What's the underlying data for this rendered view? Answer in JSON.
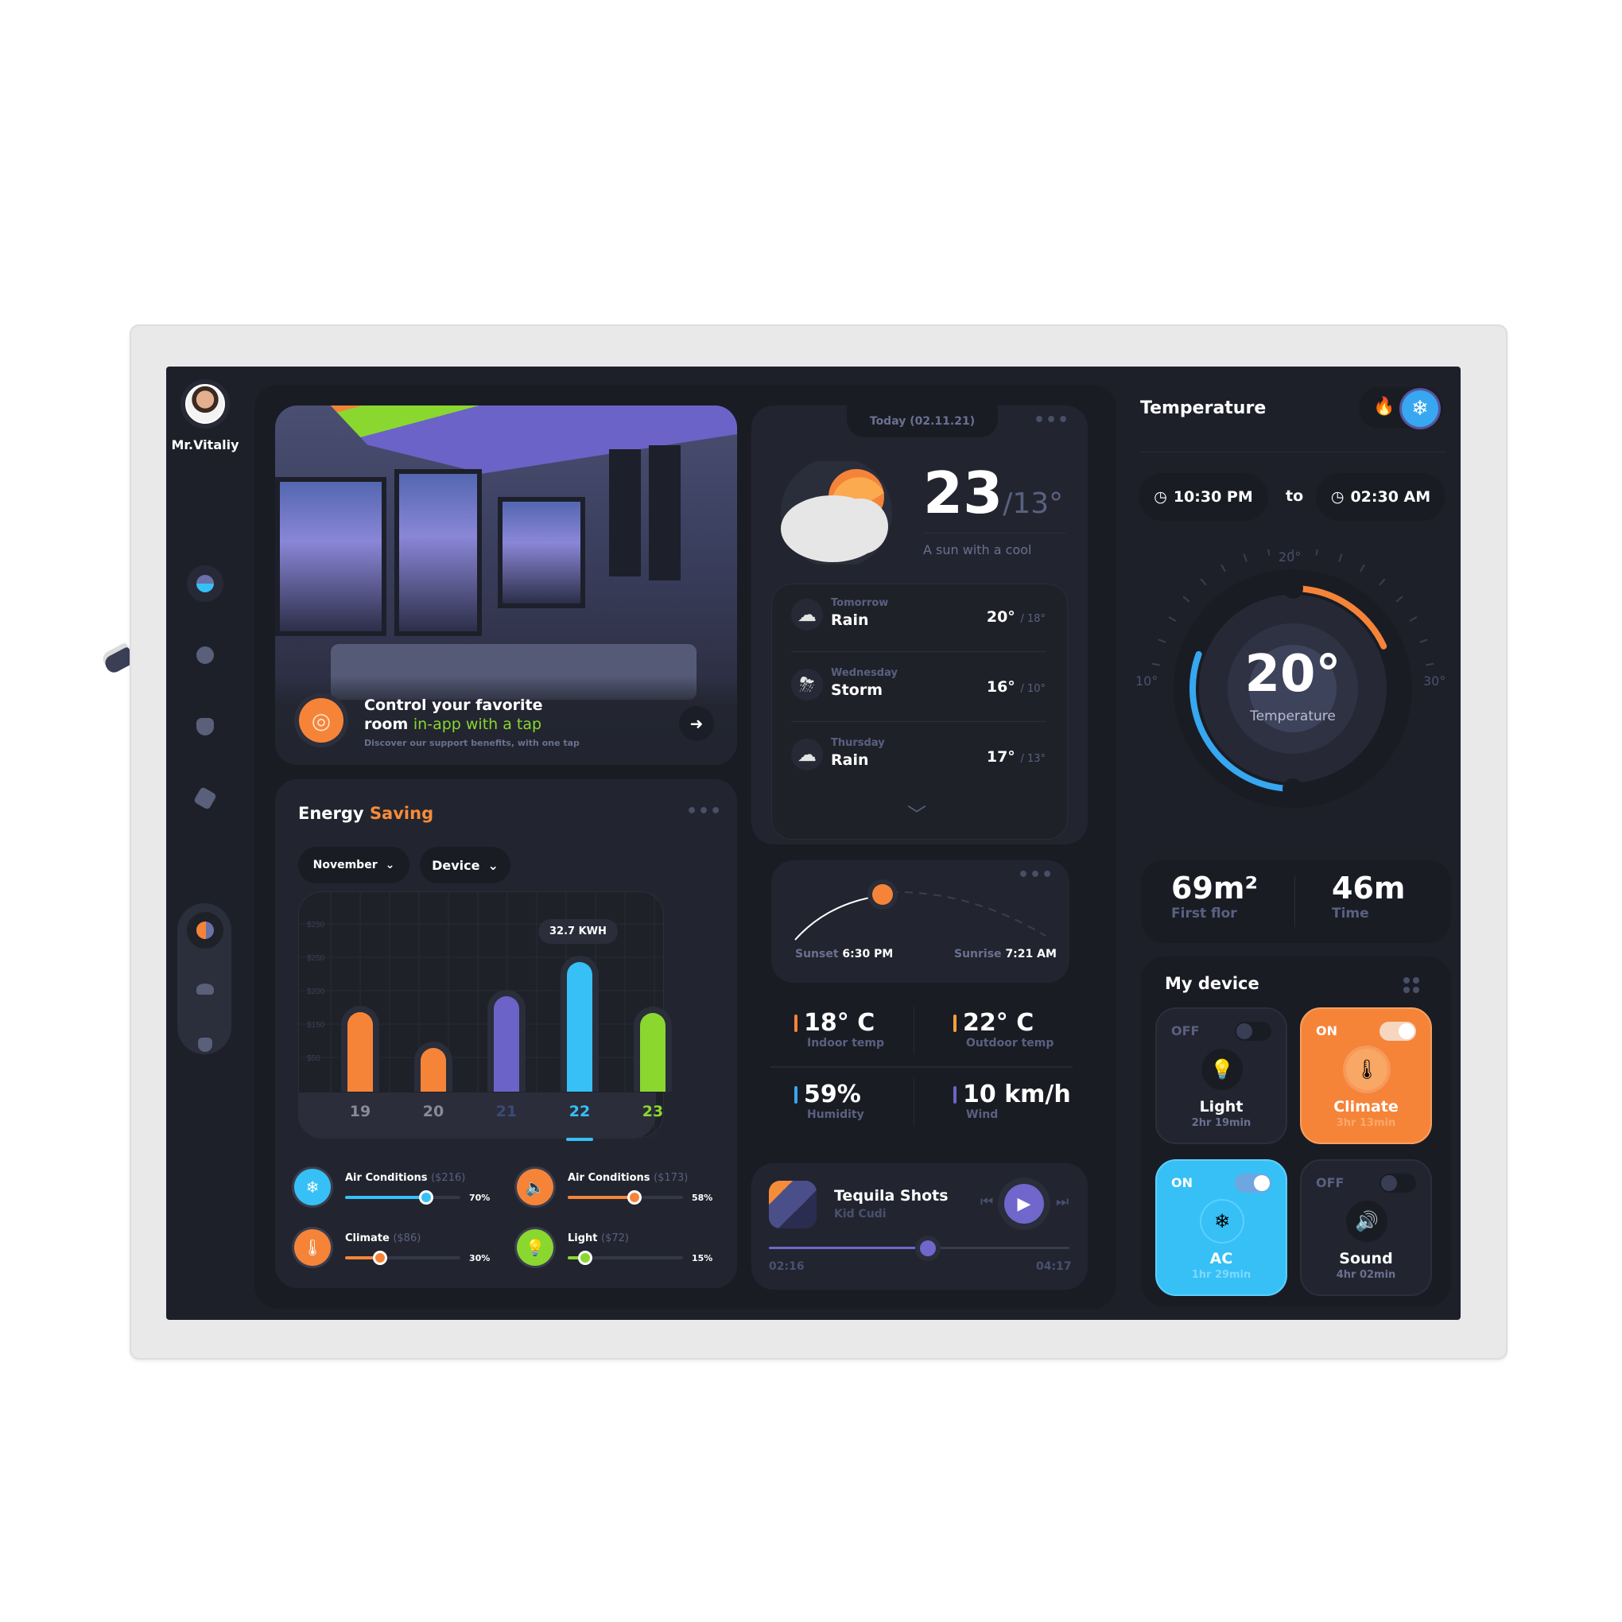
{
  "user": {
    "name": "Mr.Vitaliy"
  },
  "sidebar": {
    "items": [
      {
        "name": "home",
        "active": true
      },
      {
        "name": "light"
      },
      {
        "name": "users"
      },
      {
        "name": "box"
      }
    ],
    "bottom_items": [
      {
        "name": "theme",
        "active": true
      },
      {
        "name": "stats"
      },
      {
        "name": "profile"
      }
    ]
  },
  "hero": {
    "title_line1": "Control your favorite",
    "title_room": "room ",
    "title_highlight": "in-app with a tap",
    "subtitle": "Discover our support benefits, with one tap",
    "arrow": "➜"
  },
  "energy": {
    "title": "Energy",
    "title_accent": "Saving",
    "more": "•••",
    "month_dropdown": "November",
    "device_dropdown": "Device",
    "legend": [
      {
        "label": "Air Conditions",
        "cost": "($216)",
        "percent": "70%",
        "value": 0.7,
        "color": "#36c0f6",
        "icon": "❄"
      },
      {
        "label": "Air Conditions",
        "cost": "($173)",
        "percent": "58%",
        "value": 0.58,
        "color": "#f58439",
        "icon": "🔈"
      },
      {
        "label": "Climate",
        "cost": "($86)",
        "percent": "30%",
        "value": 0.3,
        "color": "#f58439",
        "icon": "🌡"
      },
      {
        "label": "Light",
        "cost": "($72)",
        "percent": "15%",
        "value": 0.15,
        "color": "#8ad730",
        "icon": "💡"
      }
    ]
  },
  "chart_data": {
    "type": "bar",
    "title": "Energy Saving",
    "categories": [
      "19",
      "20",
      "21",
      "22",
      "23"
    ],
    "values": [
      119,
      65,
      143,
      194,
      118
    ],
    "colors": [
      "#f58439",
      "#f58439",
      "#6c63c8",
      "#36c0f6",
      "#8ad730"
    ],
    "label_colors": [
      "#8a8a96",
      "#8a8a96",
      "#3d4a78",
      "#36c0f6",
      "#8ad730"
    ],
    "ytick_labels": [
      "$250",
      "$250",
      "$200",
      "$150",
      "$50"
    ],
    "ylim": [
      0,
      250
    ],
    "selected_index": 3,
    "tooltip": "32.7 KWH",
    "grid": true,
    "xlabel": "",
    "ylabel": ""
  },
  "weather": {
    "date": "Today (02.11.21)",
    "more": "•••",
    "temp_high": "23",
    "temp_low": "/13°",
    "description": "A sun with a cool",
    "forecast": [
      {
        "day": "Tomorrow",
        "condition": "Rain",
        "high": "20°",
        "low": "/ 18°",
        "icon": "rain"
      },
      {
        "day": "Wednesday",
        "condition": "Storm",
        "high": "16°",
        "low": "/ 10°",
        "icon": "storm"
      },
      {
        "day": "Thursday",
        "condition": "Rain",
        "high": "17°",
        "low": "/ 13°",
        "icon": "rain"
      }
    ],
    "expand": "﹀"
  },
  "sun": {
    "more": "•••",
    "sunset_label": "Sunset",
    "sunset_time": "6:30 PM",
    "sunrise_label": "Sunrise",
    "sunrise_time": "7:21 AM"
  },
  "stats": [
    {
      "value": "18° C",
      "label": "Indoor temp",
      "color": "#f58439"
    },
    {
      "value": "22° C",
      "label": "Outdoor temp",
      "color": "#f5a040"
    },
    {
      "value": "59%",
      "label": "Humidity",
      "color": "#36a7f0"
    },
    {
      "value": "10 km/h",
      "label": "Wind",
      "color": "#6c63c8"
    }
  ],
  "music": {
    "song": "Tequila Shots",
    "artist": "Kid Cudi",
    "elapsed": "02:16",
    "duration": "04:17",
    "progress": 0.53,
    "prev": "⏮",
    "play": "▶",
    "next": "⏭"
  },
  "temperature": {
    "title": "Temperature",
    "mode": "cool",
    "from_time": "10:30 PM",
    "to_label": "to",
    "to_time": "02:30 AM",
    "current": "20°",
    "current_label": "Temperature",
    "scale_min": "10°",
    "scale_mid": "20°",
    "scale_max": "30°",
    "colors": {
      "cool": "#36a7f0",
      "heat": "#f58439"
    }
  },
  "area": {
    "floor_value": "69m²",
    "floor_label": "First flor",
    "time_value": "46m",
    "time_label": "Time"
  },
  "devices": {
    "title": "My device",
    "items": [
      {
        "name": "Light",
        "state": "OFF",
        "time": "2hr 19min",
        "icon": "💡"
      },
      {
        "name": "Climate",
        "state": "ON",
        "time": "3hr 13min",
        "icon": "🌡"
      },
      {
        "name": "AC",
        "state": "ON",
        "time": "1hr 29min",
        "icon": "❄"
      },
      {
        "name": "Sound",
        "state": "OFF",
        "time": "4hr 02min",
        "icon": "🔊"
      }
    ]
  }
}
